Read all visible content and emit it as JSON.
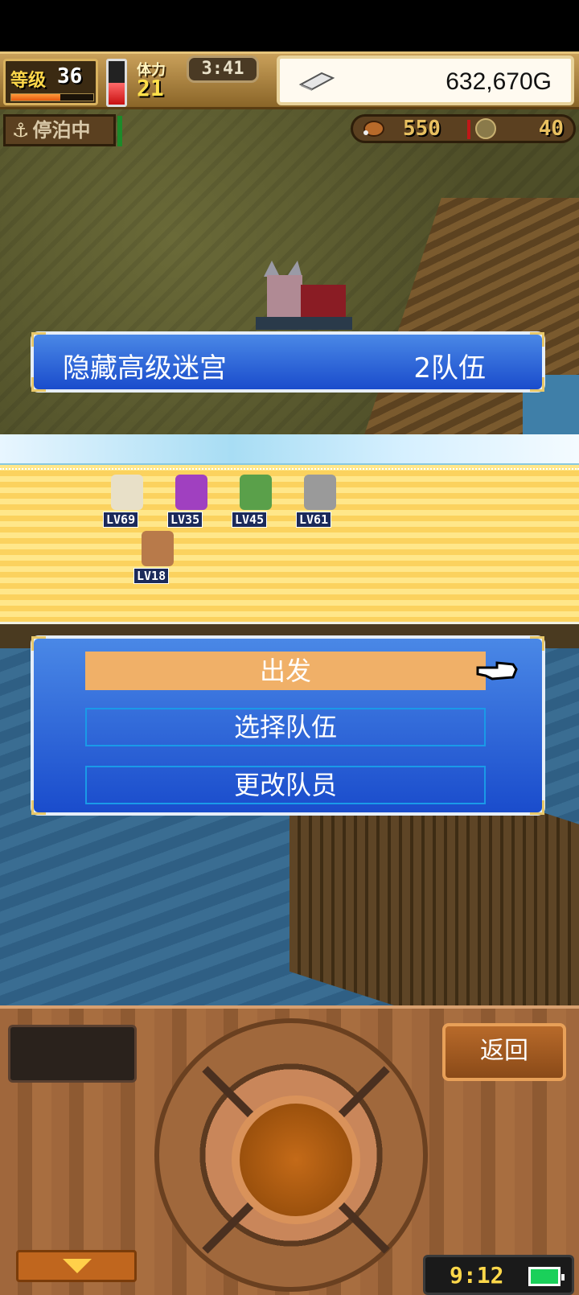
{
  "hud": {
    "level_label": "等级",
    "level_value": "36",
    "xp_fraction": 0.6,
    "stamina_fraction": 0.5,
    "stamina_label": "体力",
    "stamina_value": "21",
    "time": "3:41",
    "gold": "632,670G"
  },
  "map": {
    "status": "停泊中",
    "food": "550",
    "coins": "40"
  },
  "banner": {
    "title": "隐藏高级迷宫",
    "value": "2队伍"
  },
  "party": {
    "members": [
      {
        "level": "LV69",
        "color": "#e8e0c8"
      },
      {
        "level": "LV35",
        "color": "#a040c0"
      },
      {
        "level": "LV45",
        "color": "#5aa04a"
      },
      {
        "level": "LV61",
        "color": "#9a9a9a"
      },
      {
        "level": "LV18",
        "color": "#b87a4a"
      }
    ]
  },
  "menu": {
    "items": [
      "出发",
      "选择队伍",
      "更改队员"
    ],
    "selected_index": 0
  },
  "controls": {
    "back_label": "返回",
    "clock": "9:12"
  }
}
